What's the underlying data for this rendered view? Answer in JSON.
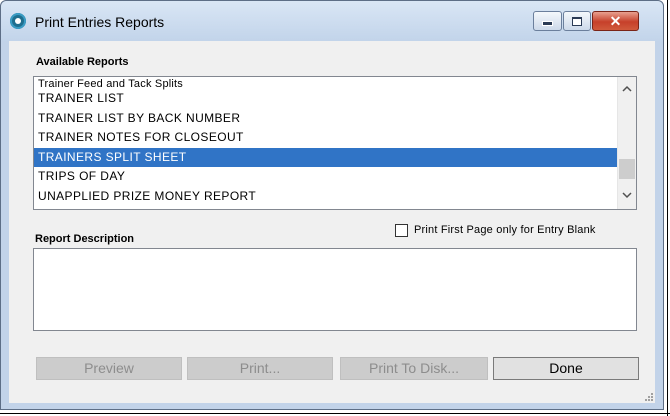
{
  "window": {
    "title": "Print Entries Reports",
    "close_glyph": "✕"
  },
  "available_reports": {
    "label": "Available Reports",
    "items": [
      {
        "label": "Trainer Feed and Tack Splits"
      },
      {
        "label": "TRAINER LIST"
      },
      {
        "label": "TRAINER LIST BY BACK NUMBER"
      },
      {
        "label": "TRAINER NOTES FOR CLOSEOUT"
      },
      {
        "label": "TRAINERS SPLIT SHEET"
      },
      {
        "label": "TRIPS OF DAY"
      },
      {
        "label": "UNAPPLIED PRIZE MONEY REPORT"
      }
    ],
    "selected": "TRAINERS SPLIT SHEET"
  },
  "report_description": {
    "label": "Report Description",
    "value": ""
  },
  "print_first_page": {
    "label": "Print First Page only for Entry Blank",
    "checked": false
  },
  "buttons": {
    "preview": "Preview",
    "print": "Print...",
    "print_to_disk": "Print To Disk...",
    "done": "Done"
  },
  "icons": {
    "app": "app-logo-icon",
    "minimize": "minimize-icon",
    "maximize": "maximize-icon",
    "close": "close-icon",
    "scroll_up": "chevron-up-icon",
    "scroll_down": "chevron-down-icon",
    "resize": "resize-grip-icon"
  },
  "colors": {
    "selection": "#3074c6",
    "frame": "#c2d3e9",
    "close_button": "#c6402a"
  }
}
